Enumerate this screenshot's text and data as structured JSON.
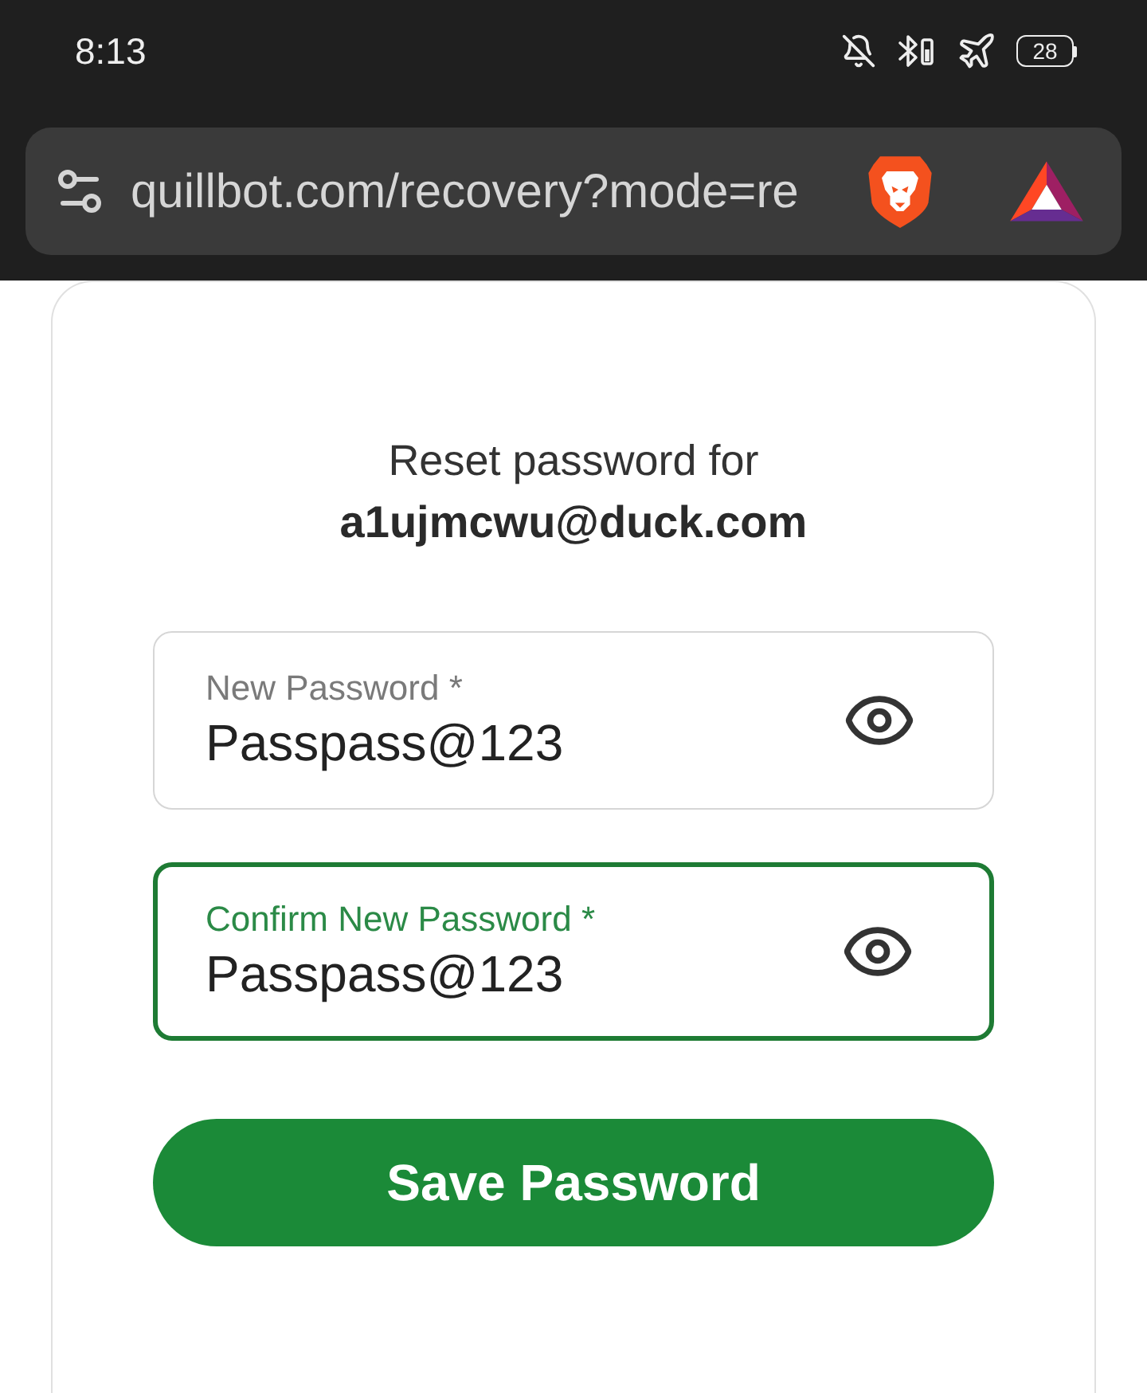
{
  "status_bar": {
    "time": "8:13",
    "battery": "28"
  },
  "address_bar": {
    "url": "quillbot.com/recovery?mode=re"
  },
  "card": {
    "heading": "Reset password for",
    "email": "a1ujmcwu@duck.com",
    "fields": [
      {
        "label": "New Password *",
        "value": "Passpass@123",
        "focused": false
      },
      {
        "label": "Confirm New Password *",
        "value": "Passpass@123",
        "focused": true
      }
    ],
    "button": "Save Password"
  }
}
